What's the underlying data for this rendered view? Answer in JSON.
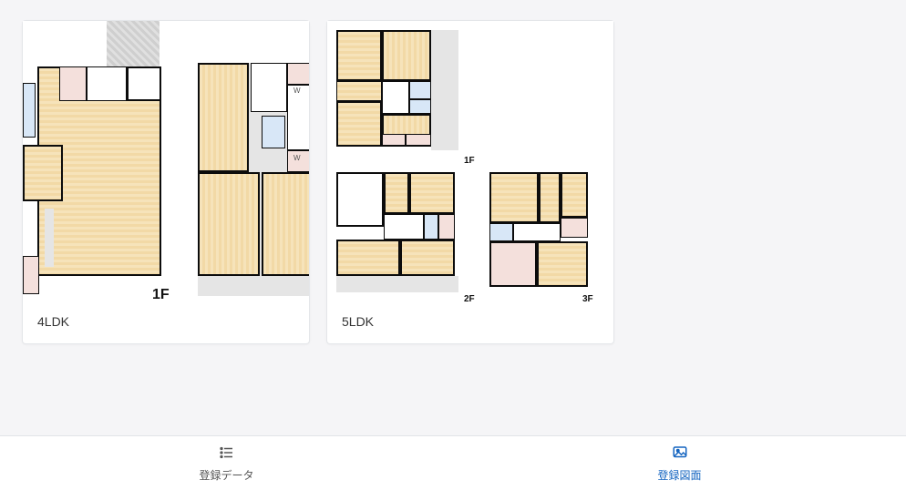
{
  "cards": [
    {
      "caption": "4LDK",
      "floors": [
        "1F"
      ]
    },
    {
      "caption": "5LDK",
      "floors": [
        "1F",
        "2F",
        "3F"
      ]
    }
  ],
  "tabs": {
    "data": {
      "label": "登録データ",
      "icon": "list"
    },
    "plan": {
      "label": "登録図面",
      "icon": "image"
    }
  }
}
